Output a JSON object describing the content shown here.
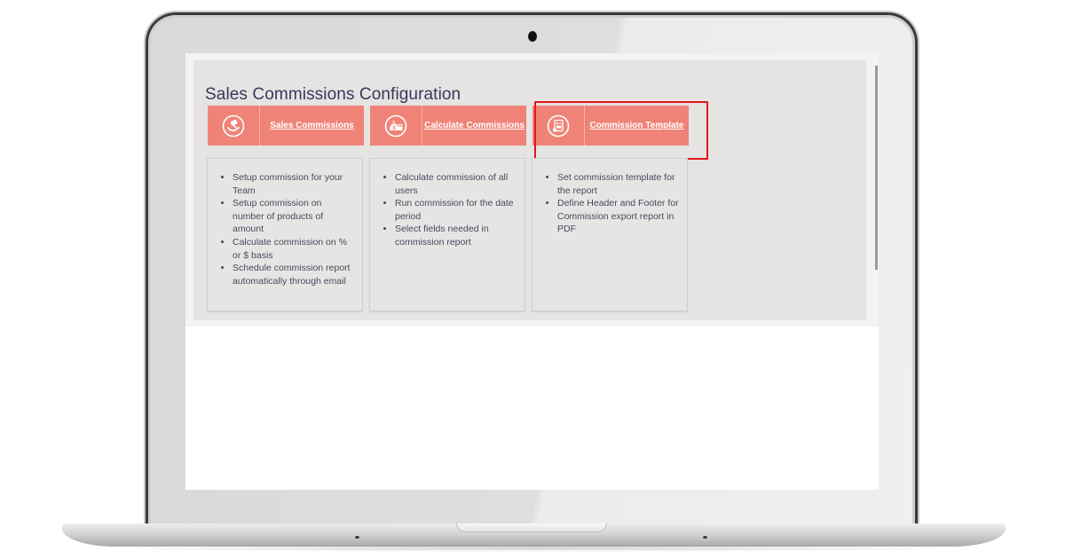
{
  "page": {
    "title": "Sales Commissions Configuration"
  },
  "colors": {
    "tile_background": "#ef8377",
    "highlight_border": "#e01818",
    "title_text": "#38385a",
    "panel_background": "#e5e4e3"
  },
  "tiles": [
    {
      "label": "Sales Commissions",
      "icon": "hand-money-icon",
      "bullets": [
        "Setup commission for your Team",
        "Setup commission on number of products of amount",
        "Calculate commission on % or $ basis",
        "Schedule commission report automatically through email"
      ]
    },
    {
      "label": "Calculate Commissions",
      "icon": "money-bag-calculator-icon",
      "bullets": [
        "Calculate commission of all users",
        "Run commission for the date period",
        "Select fields needed in commission report"
      ]
    },
    {
      "label": "Commission Template",
      "icon": "document-template-icon",
      "highlighted": true,
      "bullets": [
        "Set commission template for the report",
        "Define Header and Footer for Commission export report in PDF"
      ]
    }
  ]
}
